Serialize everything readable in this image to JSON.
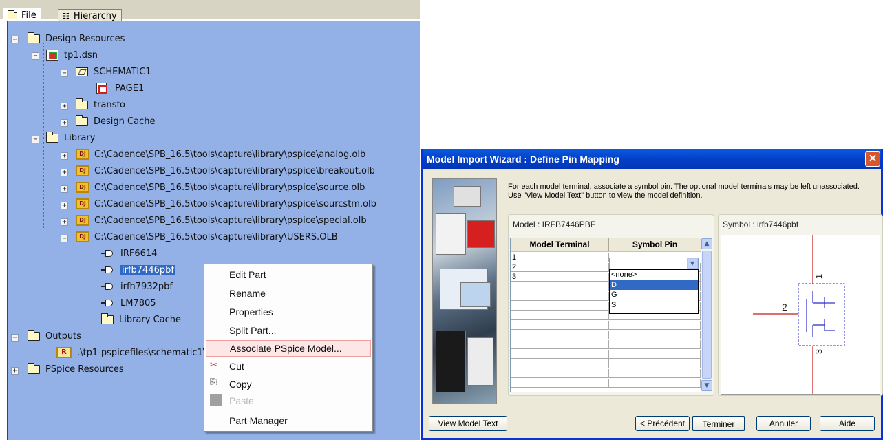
{
  "tabs": {
    "file": "File",
    "hierarchy": "Hierarchy"
  },
  "tree": {
    "design_resources": "Design Resources",
    "dsn": "tp1.dsn",
    "schematic": "SCHEMATIC1",
    "page": "PAGE1",
    "transfo": "transfo",
    "design_cache": "Design Cache",
    "library": "Library",
    "libs": [
      "C:\\Cadence\\SPB_16.5\\tools\\capture\\library\\pspice\\analog.olb",
      "C:\\Cadence\\SPB_16.5\\tools\\capture\\library\\pspice\\breakout.olb",
      "C:\\Cadence\\SPB_16.5\\tools\\capture\\library\\pspice\\source.olb",
      "C:\\Cadence\\SPB_16.5\\tools\\capture\\library\\pspice\\sourcstm.olb",
      "C:\\Cadence\\SPB_16.5\\tools\\capture\\library\\pspice\\special.olb",
      "C:\\Cadence\\SPB_16.5\\tools\\capture\\library\\USERS.OLB"
    ],
    "parts": [
      "IRF6614",
      "irfb7446pbf",
      "irfh7932pbf",
      "LM7805"
    ],
    "library_cache": "Library Cache",
    "outputs": "Outputs",
    "output_file": ".\\tp1-pspicefiles\\schematic1\\",
    "pspice_resources": "PSpice Resources",
    "lib_icon_text": "DJ"
  },
  "context_menu": {
    "edit_part": "Edit Part",
    "rename": "Rename",
    "properties": "Properties",
    "split_part": "Split Part...",
    "associate": "Associate PSpice Model...",
    "cut": "Cut",
    "copy": "Copy",
    "paste": "Paste",
    "part_manager": "Part Manager"
  },
  "wizard": {
    "title": "Model Import Wizard : Define Pin Mapping",
    "description": "For each model terminal, associate a symbol pin. The optional model terminals may be left unassociated. Use \"View Model Text\" button to view the model definition.",
    "model_label": "Model : IRFB7446PBF",
    "symbol_label": "Symbol : irfb7446pbf",
    "col_terminal": "Model Terminal",
    "col_pin": "Symbol Pin",
    "rows": [
      "1",
      "2",
      "3"
    ],
    "dropdown": [
      "<none>",
      "D",
      "G",
      "S"
    ],
    "dropdown_selected": "D",
    "symbol_pins": [
      "1",
      "2",
      "3"
    ],
    "buttons": {
      "view_model_text": "View Model Text",
      "back": "< Précédent",
      "finish": "Terminer",
      "cancel": "Annuler",
      "help": "Aide"
    }
  },
  "colors": {
    "tree_bg": "#93b1e6",
    "selection": "#316ac5",
    "title_bar": "#0a5ae0"
  }
}
